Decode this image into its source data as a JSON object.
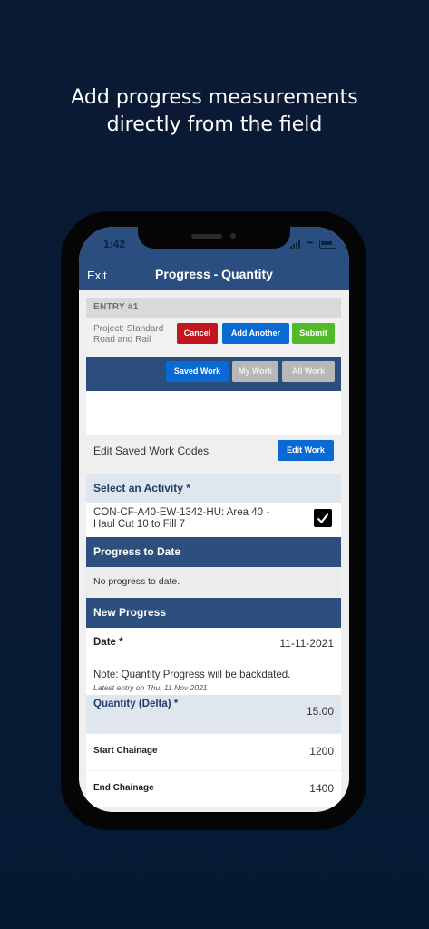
{
  "headline": [
    "Add progress measurements",
    "directly from the field"
  ],
  "status_bar": {
    "time": "1:42"
  },
  "app_bar": {
    "exit_label": "Exit",
    "title": "Progress - Quantity"
  },
  "entry": {
    "heading": "ENTRY #1",
    "project_label": "Project: Standard Road and Rail",
    "cancel_label": "Cancel",
    "add_another_label": "Add Another",
    "submit_label": "Submit"
  },
  "work_tabs": {
    "saved": "Saved Work",
    "my": "My Work",
    "all": "All Work",
    "active": "saved"
  },
  "edit_saved": {
    "label": "Edit Saved Work Codes",
    "button_label": "Edit Work"
  },
  "activity": {
    "heading": "Select an Activity *",
    "line1": "CON-CF-A40-EW-1342-HU: Area 40 -",
    "line2": "Haul Cut 10 to Fill 7",
    "checked": true
  },
  "progress_to_date": {
    "heading": "Progress to Date",
    "text": "No progress to date."
  },
  "new_progress": {
    "heading": "New Progress",
    "date_label": "Date *",
    "date_value": "11-11-2021",
    "note": "Note: Quantity Progress will be backdated.",
    "latest_entry": "Latest entry on Thu, 11 Nov 2021",
    "quantity_label": "Quantity (Delta) *",
    "quantity_value": "15.00",
    "start_chainage_label": "Start Chainage",
    "start_chainage_value": "1200",
    "end_chainage_label": "End Chainage",
    "end_chainage_value": "1400"
  },
  "colors": {
    "navy": "#2b4e80",
    "blue_button": "#0a6ad3",
    "cancel_red": "#c0161d",
    "submit_green": "#54b82b",
    "inactive_grey": "#b7b7b7"
  }
}
